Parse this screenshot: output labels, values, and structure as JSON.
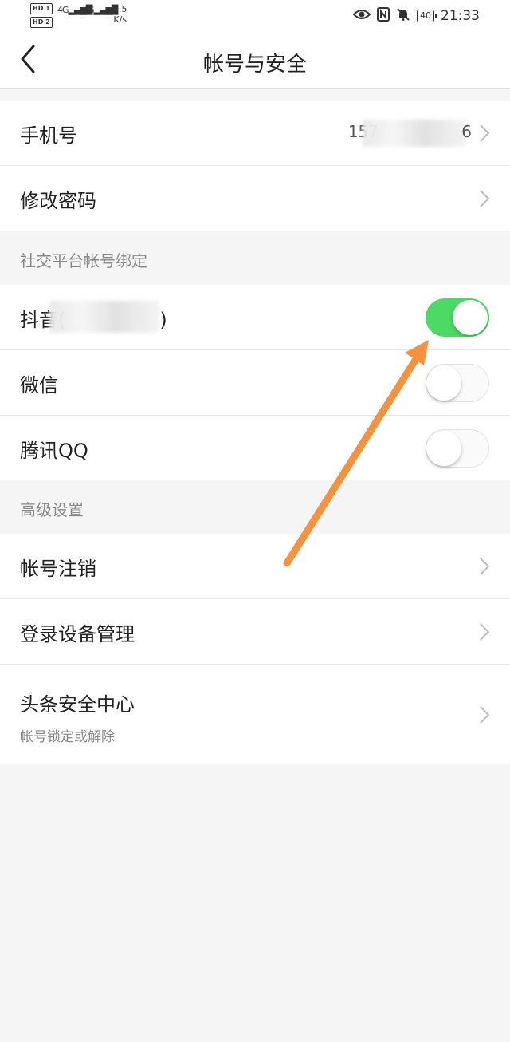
{
  "status_bar": {
    "hd1": "HD 1",
    "hd2": "HD 2",
    "net1": "4G",
    "net2": "4G",
    "speed_value": "4.5",
    "speed_unit": "K/s",
    "battery": "40",
    "time": "21:33"
  },
  "nav": {
    "back_icon": "chevron-left-icon",
    "title": "帐号与安全"
  },
  "account": {
    "phone_label": "手机号",
    "phone_value_prefix": "157",
    "phone_value_suffix": "6",
    "password_label": "修改密码"
  },
  "social": {
    "header": "社交平台帐号绑定",
    "items": [
      {
        "label": "抖音(",
        "label_tail": ")",
        "enabled": true
      },
      {
        "label": "微信",
        "enabled": false
      },
      {
        "label": "腾讯QQ",
        "enabled": false
      }
    ]
  },
  "advanced": {
    "header": "高级设置",
    "items": [
      {
        "label": "帐号注销"
      },
      {
        "label": "登录设备管理"
      },
      {
        "label": "头条安全中心",
        "sublabel": "帐号锁定或解除"
      }
    ]
  },
  "colors": {
    "toggle_on": "#4cd964",
    "annotation_arrow": "#f5923e"
  }
}
